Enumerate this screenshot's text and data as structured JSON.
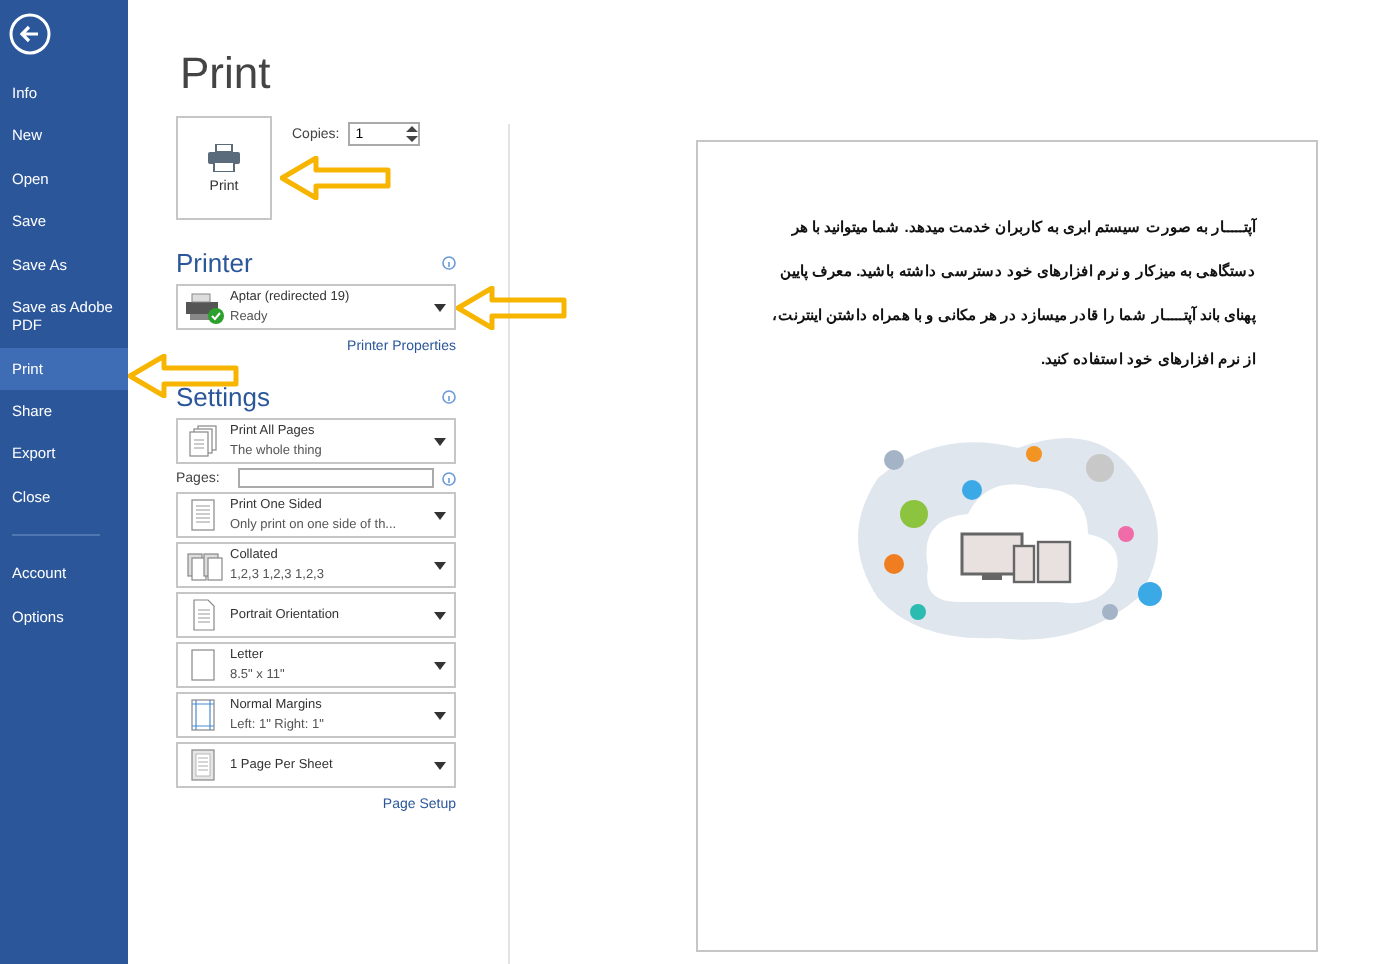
{
  "sidebar": {
    "items": [
      {
        "label": "Info",
        "selected": false
      },
      {
        "label": "New",
        "selected": false
      },
      {
        "label": "Open",
        "selected": false
      },
      {
        "label": "Save",
        "selected": false
      },
      {
        "label": "Save As",
        "selected": false
      },
      {
        "label": "Save as Adobe PDF",
        "selected": false
      },
      {
        "label": "Print",
        "selected": true
      },
      {
        "label": "Share",
        "selected": false
      },
      {
        "label": "Export",
        "selected": false
      },
      {
        "label": "Close",
        "selected": false
      }
    ],
    "footer_items": [
      {
        "label": "Account",
        "selected": false
      },
      {
        "label": "Options",
        "selected": false
      }
    ]
  },
  "title": "Print",
  "print_button": {
    "label": "Print"
  },
  "copies": {
    "label": "Copies:",
    "value": "1"
  },
  "printer": {
    "heading": "Printer",
    "name": "Aptar (redirected 19)",
    "status": "Ready",
    "properties_link": "Printer Properties"
  },
  "settings": {
    "heading": "Settings",
    "dropdowns": [
      {
        "kind": "pages",
        "title": "Print All Pages",
        "subtitle": "The whole thing"
      },
      {
        "kind": "sided",
        "title": "Print One Sided",
        "subtitle": "Only print on one side of th..."
      },
      {
        "kind": "collated",
        "title": "Collated",
        "subtitle": "1,2,3    1,2,3    1,2,3"
      },
      {
        "kind": "orientation",
        "title": "Portrait Orientation"
      },
      {
        "kind": "paper",
        "title": "Letter",
        "subtitle": "8.5\" x 11\""
      },
      {
        "kind": "margins",
        "title": "Normal Margins",
        "subtitle": "Left:  1\"    Right:  1\""
      },
      {
        "kind": "sheet",
        "title": "1 Page Per Sheet"
      }
    ],
    "pages_label": "Pages:",
    "page_setup_link": "Page Setup"
  },
  "preview": {
    "lines": [
      "آپتـــــار به صورت سیستم ابری به کاربران خدمت میدهد. شما میتوانید با هر",
      "دستگاهی به میزکار و نرم افزارهای خود دسترسی داشته باشید. معرف پایین",
      "پهنای باند آپتـــــار شما را قادر میسازد در هر مکانی و با همراه داشتن اینترنت،",
      "از نرم افزارهای خود استفاده کنید."
    ]
  }
}
